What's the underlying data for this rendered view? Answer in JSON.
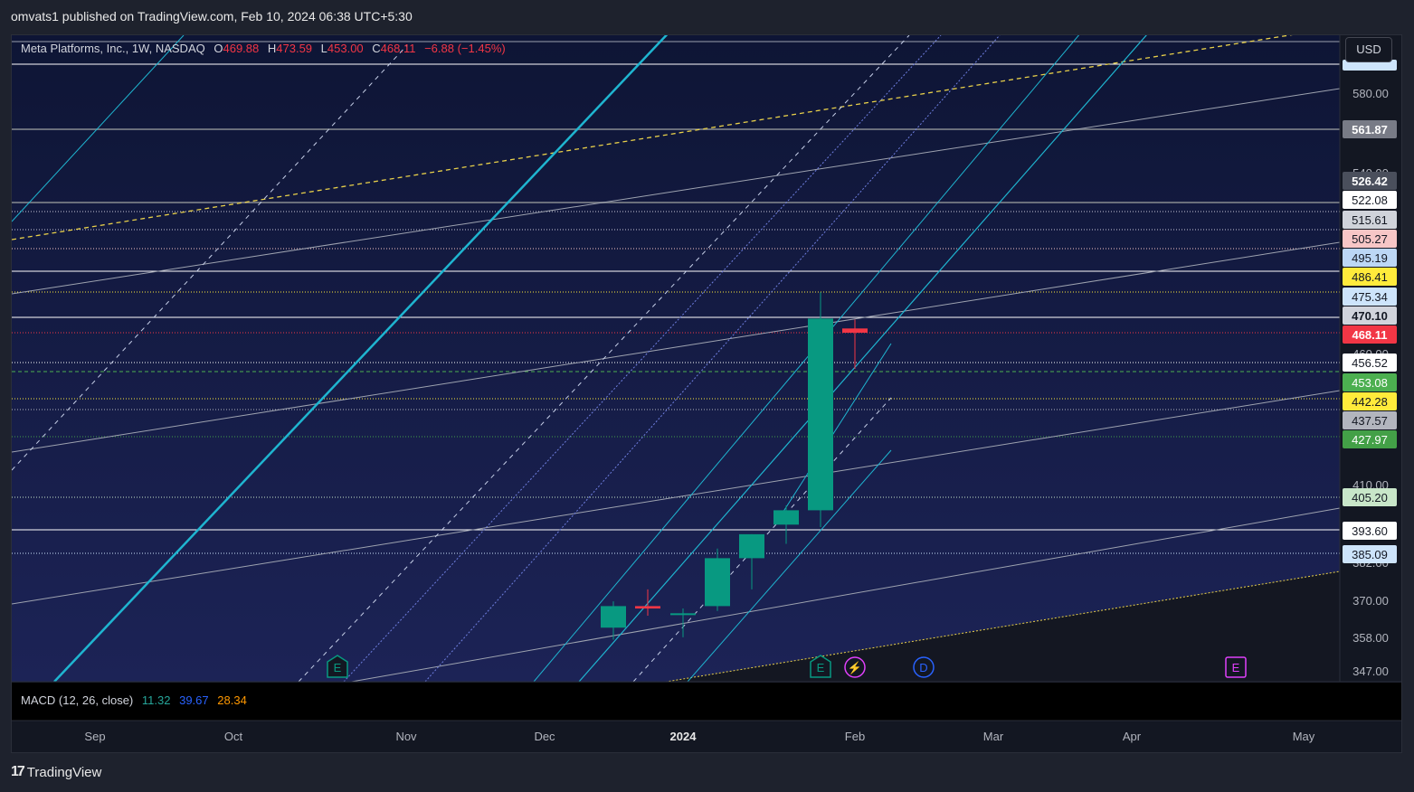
{
  "caption": "omvats1 published on TradingView.com, Feb 10, 2024 06:38 UTC+5:30",
  "legend": {
    "symbol": "Meta Platforms, Inc., 1W, NASDAQ",
    "o_label": "O",
    "o_value": "469.88",
    "h_label": "H",
    "h_value": "473.59",
    "l_label": "L",
    "l_value": "453.00",
    "c_label": "C",
    "c_value": "468.11",
    "change": "−6.88 (−1.45%)"
  },
  "currency_button": "USD",
  "macd": {
    "label": "MACD (12, 26, close)",
    "v1": "11.32",
    "v2": "39.67",
    "v3": "28.34"
  },
  "footer": {
    "brand": "TradingView",
    "mark": "17"
  },
  "event_markers": [
    {
      "letter": "E",
      "kind": "earnings"
    },
    {
      "letter": "E",
      "kind": "earnings"
    },
    {
      "letter": "⚡",
      "kind": "split"
    },
    {
      "letter": "D",
      "kind": "dividend"
    },
    {
      "letter": "E",
      "kind": "earnings-future"
    }
  ],
  "colors": {
    "up": "#089981",
    "down": "#f23645",
    "background": "#131722",
    "channel": "#1fb5d0",
    "yellow_trend": "#e8d04a"
  },
  "chart_data": {
    "type": "candlestick",
    "timeframe": "1W",
    "x_tick_labels": [
      "Sep",
      "Oct",
      "Nov",
      "Dec",
      "2024",
      "Feb",
      "Mar",
      "Apr",
      "May"
    ],
    "y_tick_labels": [
      "580.00",
      "347.00",
      "358.00",
      "370.00",
      "410.00"
    ],
    "ylim": [
      340,
      600
    ],
    "candles": [
      {
        "date": "2023-12-18",
        "open": 345,
        "high": 356,
        "low": 340,
        "close": 354
      },
      {
        "date": "2023-12-25",
        "open": 354,
        "high": 361,
        "low": 350,
        "close": 353
      },
      {
        "date": "2024-01-01",
        "open": 351,
        "high": 353,
        "low": 341,
        "close": 351
      },
      {
        "date": "2024-01-08",
        "open": 354,
        "high": 378,
        "low": 352,
        "close": 374
      },
      {
        "date": "2024-01-15",
        "open": 374,
        "high": 384,
        "low": 361,
        "close": 384
      },
      {
        "date": "2024-01-22",
        "open": 388,
        "high": 396,
        "low": 380,
        "close": 394
      },
      {
        "date": "2024-01-29",
        "open": 394,
        "high": 485,
        "low": 387,
        "close": 474
      },
      {
        "date": "2024-02-05",
        "open": 469.88,
        "high": 473.59,
        "low": 453.0,
        "close": 468.11
      }
    ],
    "price_labels": [
      {
        "value": "561.87",
        "bg": "#787b86",
        "fg": "#ffffff"
      },
      {
        "value": "526.42",
        "bg": "#4a4f5c",
        "fg": "#ffffff"
      },
      {
        "value": "522.08",
        "bg": "#ffffff",
        "fg": "#131722"
      },
      {
        "value": "515.61",
        "bg": "#d0d3da",
        "fg": "#131722"
      },
      {
        "value": "505.27",
        "bg": "#f7c6c6",
        "fg": "#131722"
      },
      {
        "value": "495.19",
        "bg": "#bcd7f5",
        "fg": "#131722"
      },
      {
        "value": "486.41",
        "bg": "#ffeb3b",
        "fg": "#131722"
      },
      {
        "value": "475.34",
        "bg": "#cde4fb",
        "fg": "#131722"
      },
      {
        "value": "470.10",
        "bg": "#d1d4dc",
        "fg": "#131722"
      },
      {
        "value": "468.11",
        "bg": "#f23645",
        "fg": "#ffffff"
      },
      {
        "value": "456.52",
        "bg": "#ffffff",
        "fg": "#131722"
      },
      {
        "value": "453.08",
        "bg": "#4caf50",
        "fg": "#ffffff"
      },
      {
        "value": "442.28",
        "bg": "#ffeb3b",
        "fg": "#131722"
      },
      {
        "value": "437.57",
        "bg": "#b2b5be",
        "fg": "#131722"
      },
      {
        "value": "427.97",
        "bg": "#43a047",
        "fg": "#ffffff"
      },
      {
        "value": "405.20",
        "bg": "#c8e6c9",
        "fg": "#131722"
      },
      {
        "value": "393.60",
        "bg": "#ffffff",
        "fg": "#131722"
      },
      {
        "value": "385.09",
        "bg": "#cde4fb",
        "fg": "#131722"
      }
    ]
  }
}
